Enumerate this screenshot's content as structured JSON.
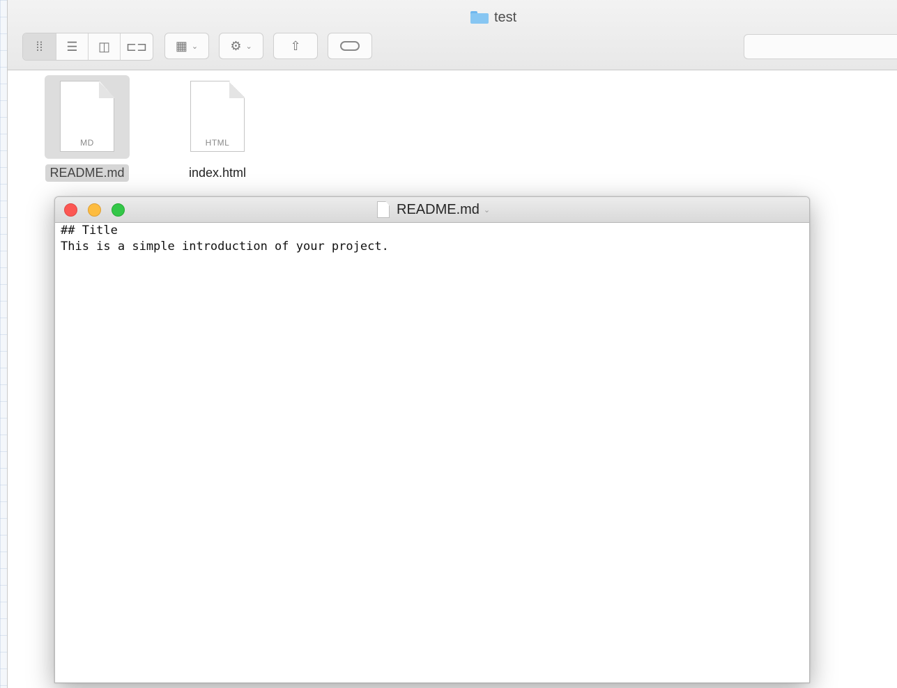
{
  "finder": {
    "title": "test",
    "toolbar": {
      "view_buttons": [
        {
          "name": "icon-view-button",
          "glyph": "⁞⁞",
          "active": true
        },
        {
          "name": "list-view-button",
          "glyph": "☰",
          "active": false
        },
        {
          "name": "column-view-button",
          "glyph": "◫",
          "active": false
        },
        {
          "name": "cover-flow-button",
          "glyph": "⊏⊐",
          "active": false
        }
      ],
      "arrange_glyph": "▦",
      "action_glyph": "⚙",
      "share_glyph": "⇧",
      "chevron_glyph": "⌄"
    },
    "files": [
      {
        "name": "README.md",
        "badge": "MD",
        "selected": true
      },
      {
        "name": "index.html",
        "badge": "HTML",
        "selected": false
      }
    ]
  },
  "textedit": {
    "title": "README.md",
    "chevron": "⌄",
    "content": "## Title\nThis is a simple introduction of your project."
  },
  "colors": {
    "close": "#fc5753",
    "minimize": "#fdbc40",
    "zoom": "#33c748",
    "folder": "#87c6f2",
    "selection": "#d6d6d6"
  }
}
